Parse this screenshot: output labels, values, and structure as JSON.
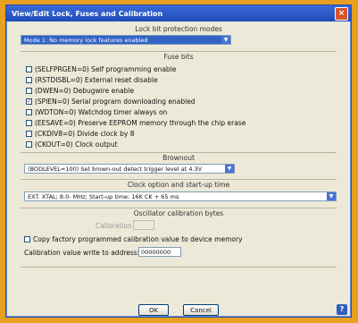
{
  "window": {
    "title": "View/Edit Lock, Fuses and Calibration",
    "close_label": "×"
  },
  "lock": {
    "section_label": "Lock bit protection modes",
    "selected": "Mode 1: No memory lock features enabled"
  },
  "fuses": {
    "section_label": "Fuse bits",
    "items": [
      {
        "label": "(SELFPRGEN=0) Self programming enable",
        "checked": false
      },
      {
        "label": "(RSTDISBL=0) External reset disable",
        "checked": false
      },
      {
        "label": "(DWEN=0) Debugwire enable",
        "checked": false
      },
      {
        "label": "(SPIEN=0) Serial program downloading enabled",
        "checked": true
      },
      {
        "label": "(WDTON=0) Watchdog timer always on",
        "checked": false
      },
      {
        "label": "(EESAVE=0) Preserve EEPROM memory through the chip erase",
        "checked": false
      },
      {
        "label": "(CKDIV8=0) Divide clock by 8",
        "checked": false
      },
      {
        "label": "(CKOUT=0) Clock output",
        "checked": false
      }
    ]
  },
  "brownout": {
    "section_label": "Brownout",
    "selected": "(BODLEVEL=100) Set brown-out detect trigger level at 4.3V"
  },
  "clock": {
    "section_label": "Clock option and start-up time",
    "selected": "EXT. XTAL; 8.0- MHz; Start-up time: 16K CK + 65 ms"
  },
  "calibration": {
    "section_label": "Oscillator calibration bytes",
    "value_label": "Calibration value",
    "value": "",
    "copy_label": "Copy factory programmed calibration value to device memory",
    "copy_checked": false,
    "address_label": "Calibration value write to address:",
    "address_value": "00000000"
  },
  "buttons": {
    "ok": "OK",
    "cancel": "Cancel",
    "help": "?"
  },
  "colors": {
    "accent": "#3163c5",
    "window_bg": "#ece9d8",
    "frame": "#e8a020"
  }
}
